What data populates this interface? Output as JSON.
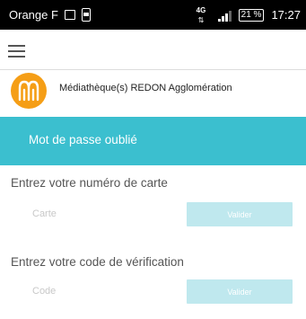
{
  "status_bar": {
    "carrier": "Orange F",
    "network": "4G",
    "battery": "21 %",
    "time": "17:27"
  },
  "header": {
    "library_name": "Médiathèque(s) REDON Agglomération"
  },
  "page": {
    "title": "Mot de passe oublié"
  },
  "card_section": {
    "label": "Entrez votre numéro de carte",
    "placeholder": "Carte",
    "button_label": "Valider"
  },
  "code_section": {
    "label": "Entrez votre code de vérification",
    "placeholder": "Code",
    "button_label": "Valider"
  },
  "colors": {
    "accent": "#3bbfcf",
    "button_bg": "#bfe8ee",
    "logo": "#f59e16"
  }
}
